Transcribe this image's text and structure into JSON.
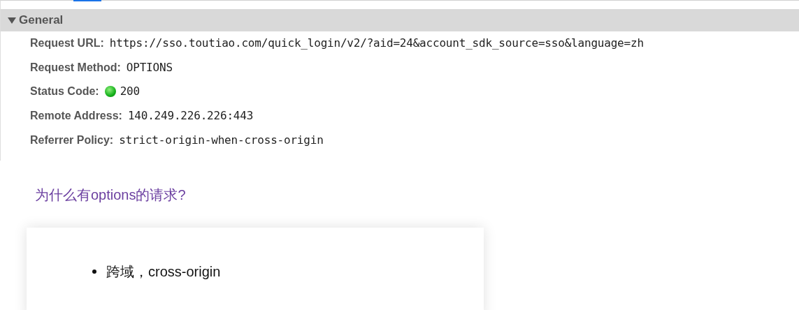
{
  "section": {
    "title": "General",
    "expanded": true
  },
  "fields": [
    {
      "kind": "text",
      "label": "Request URL:",
      "value": "https://sso.toutiao.com/quick_login/v2/?aid=24&account_sdk_source=sso&language=zh"
    },
    {
      "kind": "text",
      "label": "Request Method:",
      "value": "OPTIONS"
    },
    {
      "kind": "status",
      "label": "Status Code:",
      "value": "200"
    },
    {
      "kind": "text",
      "label": "Remote Address:",
      "value": "140.249.226.226:443"
    },
    {
      "kind": "text",
      "label": "Referrer Policy:",
      "value": "strict-origin-when-cross-origin"
    }
  ],
  "article": {
    "heading": "为什么有options的请求?",
    "bullets": [
      "跨域，cross-origin"
    ]
  }
}
